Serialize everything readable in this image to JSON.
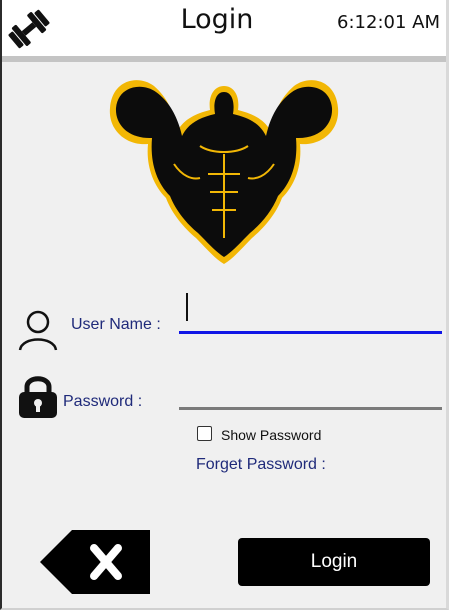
{
  "window": {
    "title": "Login",
    "clock": "6:12:01 AM",
    "app_icon": "dumbbell-icon"
  },
  "logo": {
    "icon": "muscular-bodybuilder-logo",
    "colors": {
      "fill": "#0c0c0c",
      "outline": "#f2b705"
    }
  },
  "form": {
    "username": {
      "icon": "user-icon",
      "label": "User Name :",
      "value": "",
      "underline_color": "#1016e6"
    },
    "password": {
      "icon": "lock-icon",
      "label": "Password :",
      "value": "",
      "underline_color": "#7a7a7a"
    },
    "show_password": {
      "label": "Show Password",
      "checked": false
    },
    "forget_password": {
      "label": "Forget Password :"
    }
  },
  "actions": {
    "back_icon": "close-x-icon",
    "login_label": "Login"
  },
  "colors": {
    "accent_label": "#1f2a7a",
    "button_bg": "#000000",
    "window_bg": "#f0f0f0"
  }
}
